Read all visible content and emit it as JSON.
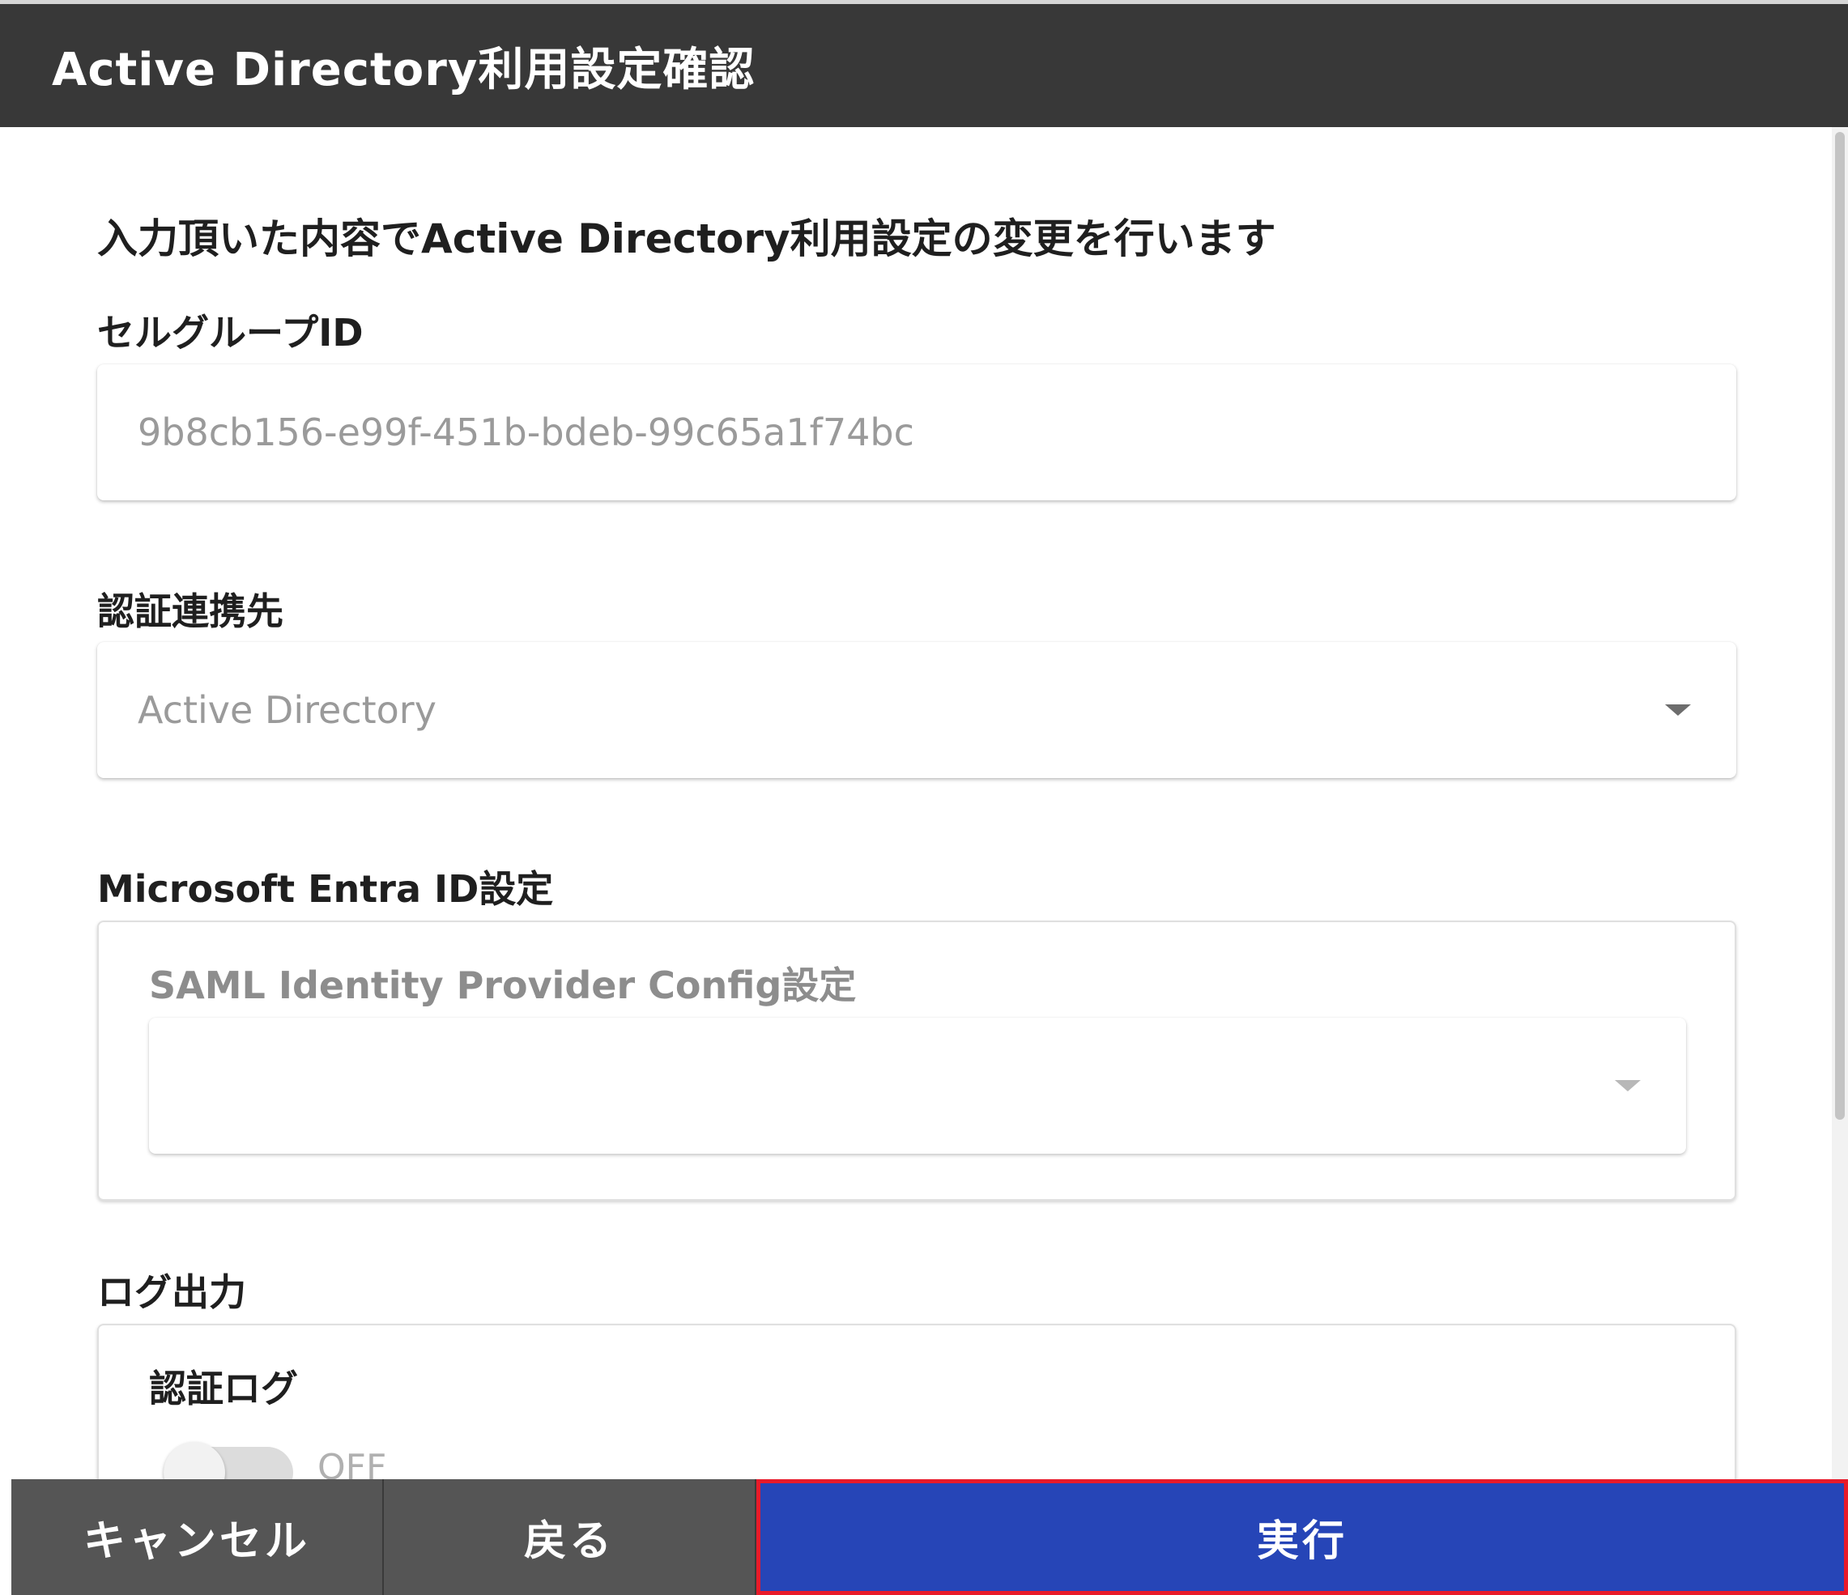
{
  "dialog": {
    "title": "Active Directory利用設定確認",
    "intro": "入力頂いた内容でActive Directory利用設定の変更を行います"
  },
  "fields": {
    "cell_group_id": {
      "label": "セルグループID",
      "value": "9b8cb156-e99f-451b-bdeb-99c65a1f74bc"
    },
    "auth_provider": {
      "label": "認証連携先",
      "value": "Active Directory"
    },
    "entra": {
      "label": "Microsoft Entra ID設定",
      "saml_label": "SAML Identity Provider Config設定",
      "saml_value": ""
    },
    "log_output": {
      "label": "ログ出力",
      "auth_log_label": "認証ログ",
      "auth_log_state": "OFF"
    }
  },
  "footer": {
    "cancel_label": "キャンセル",
    "back_label": "戻る",
    "execute_label": "実行"
  },
  "colors": {
    "titlebar": "#383838",
    "execute": "#2645b7",
    "execute_highlight": "#e81a2a",
    "secondary_button": "#555555"
  }
}
